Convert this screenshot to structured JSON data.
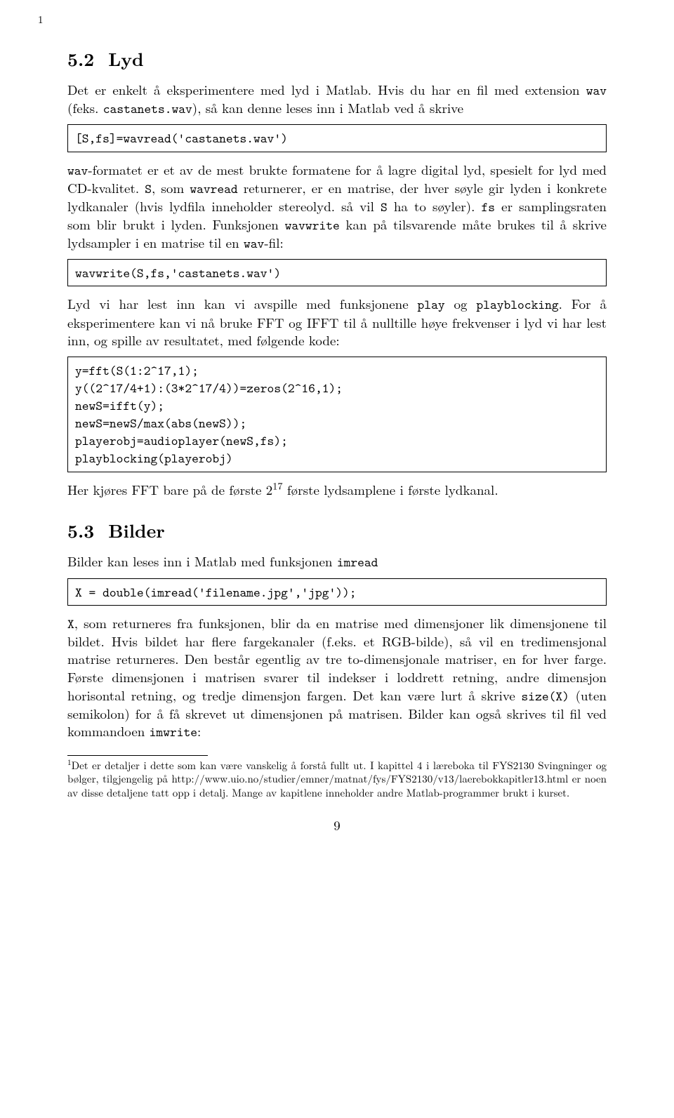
{
  "page_top_marker": "1",
  "page_number": "9",
  "section52": {
    "number": "5.2",
    "title": "Lyd",
    "para1_a": "Det er enkelt å eksperimentere med lyd i Matlab. Hvis du har en fil med extension ",
    "para1_tt1": "wav",
    "para1_b": " (feks. ",
    "para1_tt2": "castanets.wav",
    "para1_c": "), så kan denne leses inn i Matlab ved å skrive",
    "code1": "[S,fs]=wavread('castanets.wav')",
    "para2_tt1": "wav",
    "para2_a": "-formatet er et av de mest brukte formatene for å lagre digital lyd, spesielt for lyd med CD-kvalitet. ",
    "para2_tt2": "S",
    "para2_b": ", som ",
    "para2_tt3": "wavread",
    "para2_c": " returnerer, er en matrise, der hver søyle gir lyden i konkrete lydkanaler (hvis lydfila inneholder stereolyd. så vil ",
    "para2_tt4": "S",
    "para2_d": " ha to søyler). ",
    "para2_tt5": "fs",
    "para2_e": " er samplingsraten som blir brukt i lyden. Funksjonen ",
    "para2_tt6": "wavwrite",
    "para2_f": " kan på tilsvarende måte brukes til å skrive lydsampler i en matrise til en ",
    "para2_tt7": "wav",
    "para2_g": "-fil:",
    "code2": "wavwrite(S,fs,'castanets.wav')",
    "para3_a": "Lyd vi har lest inn kan vi avspille med funksjonene ",
    "para3_tt1": "play",
    "para3_b": " og ",
    "para3_tt2": "playblocking",
    "para3_c": ". For å eksperimentere kan vi nå bruke FFT og IFFT til å nulltille høye frekvenser i lyd vi har lest inn, og spille av resultatet, med følgende kode:",
    "code3": "y=fft(S(1:2^17,1);\ny((2^17/4+1):(3*2^17/4))=zeros(2^16,1);\nnewS=ifft(y);\nnewS=newS/max(abs(newS));\nplayerobj=audioplayer(newS,fs);\nplayblocking(playerobj)",
    "para4_a": "Her kjøres FFT bare på de første 2",
    "para4_sup": "17",
    "para4_b": " første lydsamplene i første lydkanal."
  },
  "section53": {
    "number": "5.3",
    "title": "Bilder",
    "para1_a": "Bilder kan leses inn i Matlab med funksjonen ",
    "para1_tt1": "imread",
    "code1": "X = double(imread('filename.jpg','jpg'));",
    "para2_tt1": "X",
    "para2_a": ", som returneres fra funksjonen, blir da en matrise med dimensjoner lik dimensjonene til bildet. Hvis bildet har flere fargekanaler (f.eks. et RGB-bilde), så vil en tredimensjonal matrise returneres. Den består egentlig av tre to-dimensjonale matriser, en for hver farge. Første dimensjonen i matrisen svarer til indekser i loddrett retning, andre dimensjon horisontal retning, og tredje dimensjon fargen. Det kan være lurt å skrive ",
    "para2_tt2": "size(X)",
    "para2_b": " (uten semikolon) for å få skrevet ut dimensjonen på matrisen. Bilder kan også skrives til fil ved kommandoen ",
    "para2_tt3": "imwrite",
    "para2_c": ":"
  },
  "footnote": {
    "marker": "1",
    "text_a": "Det er detaljer i dette som kan være vanskelig å forstå fullt ut. I kapittel 4 i læreboka til FYS2130 Svingninger og bølger, tilgjengelig på http://www.uio.no/studier/emner/matnat/fys/FYS2130/v13/laerebokkapitler13.html er noen av disse detaljene tatt opp i detalj. Mange av kapitlene inneholder andre Matlab-programmer brukt i kurset."
  }
}
